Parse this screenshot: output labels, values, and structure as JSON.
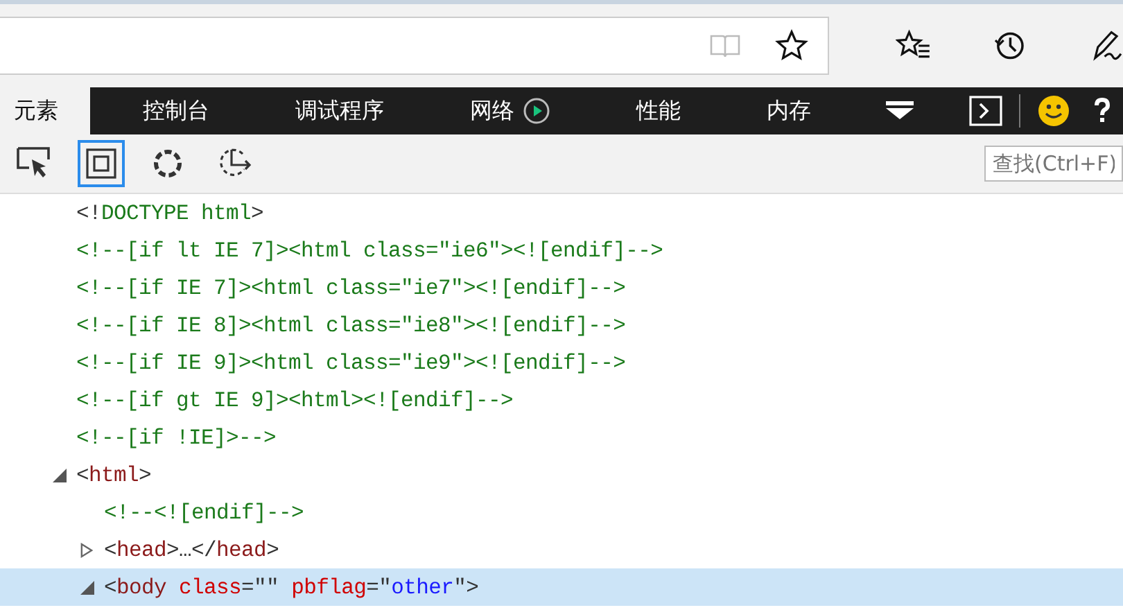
{
  "address_bar": {
    "reading_view_disabled": true
  },
  "devtools_tabs": [
    {
      "label": "元素",
      "selected": true,
      "kind": "text"
    },
    {
      "label": "控制台",
      "selected": false,
      "kind": "text"
    },
    {
      "label": "调试程序",
      "selected": false,
      "kind": "text"
    },
    {
      "label": "网络",
      "selected": false,
      "kind": "network"
    },
    {
      "label": "性能",
      "selected": false,
      "kind": "text"
    },
    {
      "label": "内存",
      "selected": false,
      "kind": "text"
    }
  ],
  "toolbar": {
    "tools": [
      {
        "kind": "select",
        "selected": false
      },
      {
        "kind": "box",
        "selected": true
      },
      {
        "kind": "circle",
        "selected": false
      },
      {
        "kind": "timer",
        "selected": false
      }
    ],
    "search": {
      "placeholder": "查找(Ctrl+F)"
    }
  },
  "dom_tree": [
    {
      "selected": false,
      "tokens": [
        {
          "kind": "punct",
          "text": "<!"
        },
        {
          "kind": "comment",
          "text": "DOCTYPE html"
        },
        {
          "kind": "punct",
          "text": ">"
        }
      ]
    },
    {
      "selected": false,
      "tokens": [
        {
          "kind": "comment",
          "text": "<!--[if lt IE 7]><html class=\"ie6\"><![endif]-->"
        }
      ]
    },
    {
      "selected": false,
      "tokens": [
        {
          "kind": "comment",
          "text": "<!--[if IE 7]><html class=\"ie7\"><![endif]-->"
        }
      ]
    },
    {
      "selected": false,
      "tokens": [
        {
          "kind": "comment",
          "text": "<!--[if IE 8]><html class=\"ie8\"><![endif]-->"
        }
      ]
    },
    {
      "selected": false,
      "tokens": [
        {
          "kind": "comment",
          "text": "<!--[if IE 9]><html class=\"ie9\"><![endif]-->"
        }
      ]
    },
    {
      "selected": false,
      "tokens": [
        {
          "kind": "comment",
          "text": "<!--[if gt IE 9]><html><![endif]-->"
        }
      ]
    },
    {
      "selected": false,
      "tokens": [
        {
          "kind": "comment",
          "text": "<!--[if !IE]>-->"
        }
      ]
    },
    {
      "tokens": [
        {
          "kind": "punct",
          "text": "<"
        },
        {
          "kind": "tag",
          "text": "html"
        },
        {
          "kind": "punct",
          "text": ">"
        }
      ],
      "expanded": true,
      "selected": false,
      "children": [
        {
          "selected": false,
          "tokens": [
            {
              "kind": "comment",
              "text": "<!--<![endif]-->"
            }
          ]
        },
        {
          "tokens": [
            {
              "kind": "punct",
              "text": "<"
            },
            {
              "kind": "tag",
              "text": "head"
            },
            {
              "kind": "punct",
              "text": ">…</"
            },
            {
              "kind": "tag",
              "text": "head"
            },
            {
              "kind": "punct",
              "text": ">"
            }
          ],
          "expanded": false,
          "selected": false
        },
        {
          "tokens": [
            {
              "kind": "punct",
              "text": "<"
            },
            {
              "kind": "tag",
              "text": "body"
            },
            {
              "kind": "attr",
              "text": " class"
            },
            {
              "kind": "punct",
              "text": "=\"\" "
            },
            {
              "kind": "attr",
              "text": "pbflag"
            },
            {
              "kind": "punct",
              "text": "=\""
            },
            {
              "kind": "value",
              "text": "other"
            },
            {
              "kind": "punct",
              "text": "\">"
            }
          ],
          "expanded": true,
          "selected": true
        }
      ]
    }
  ]
}
